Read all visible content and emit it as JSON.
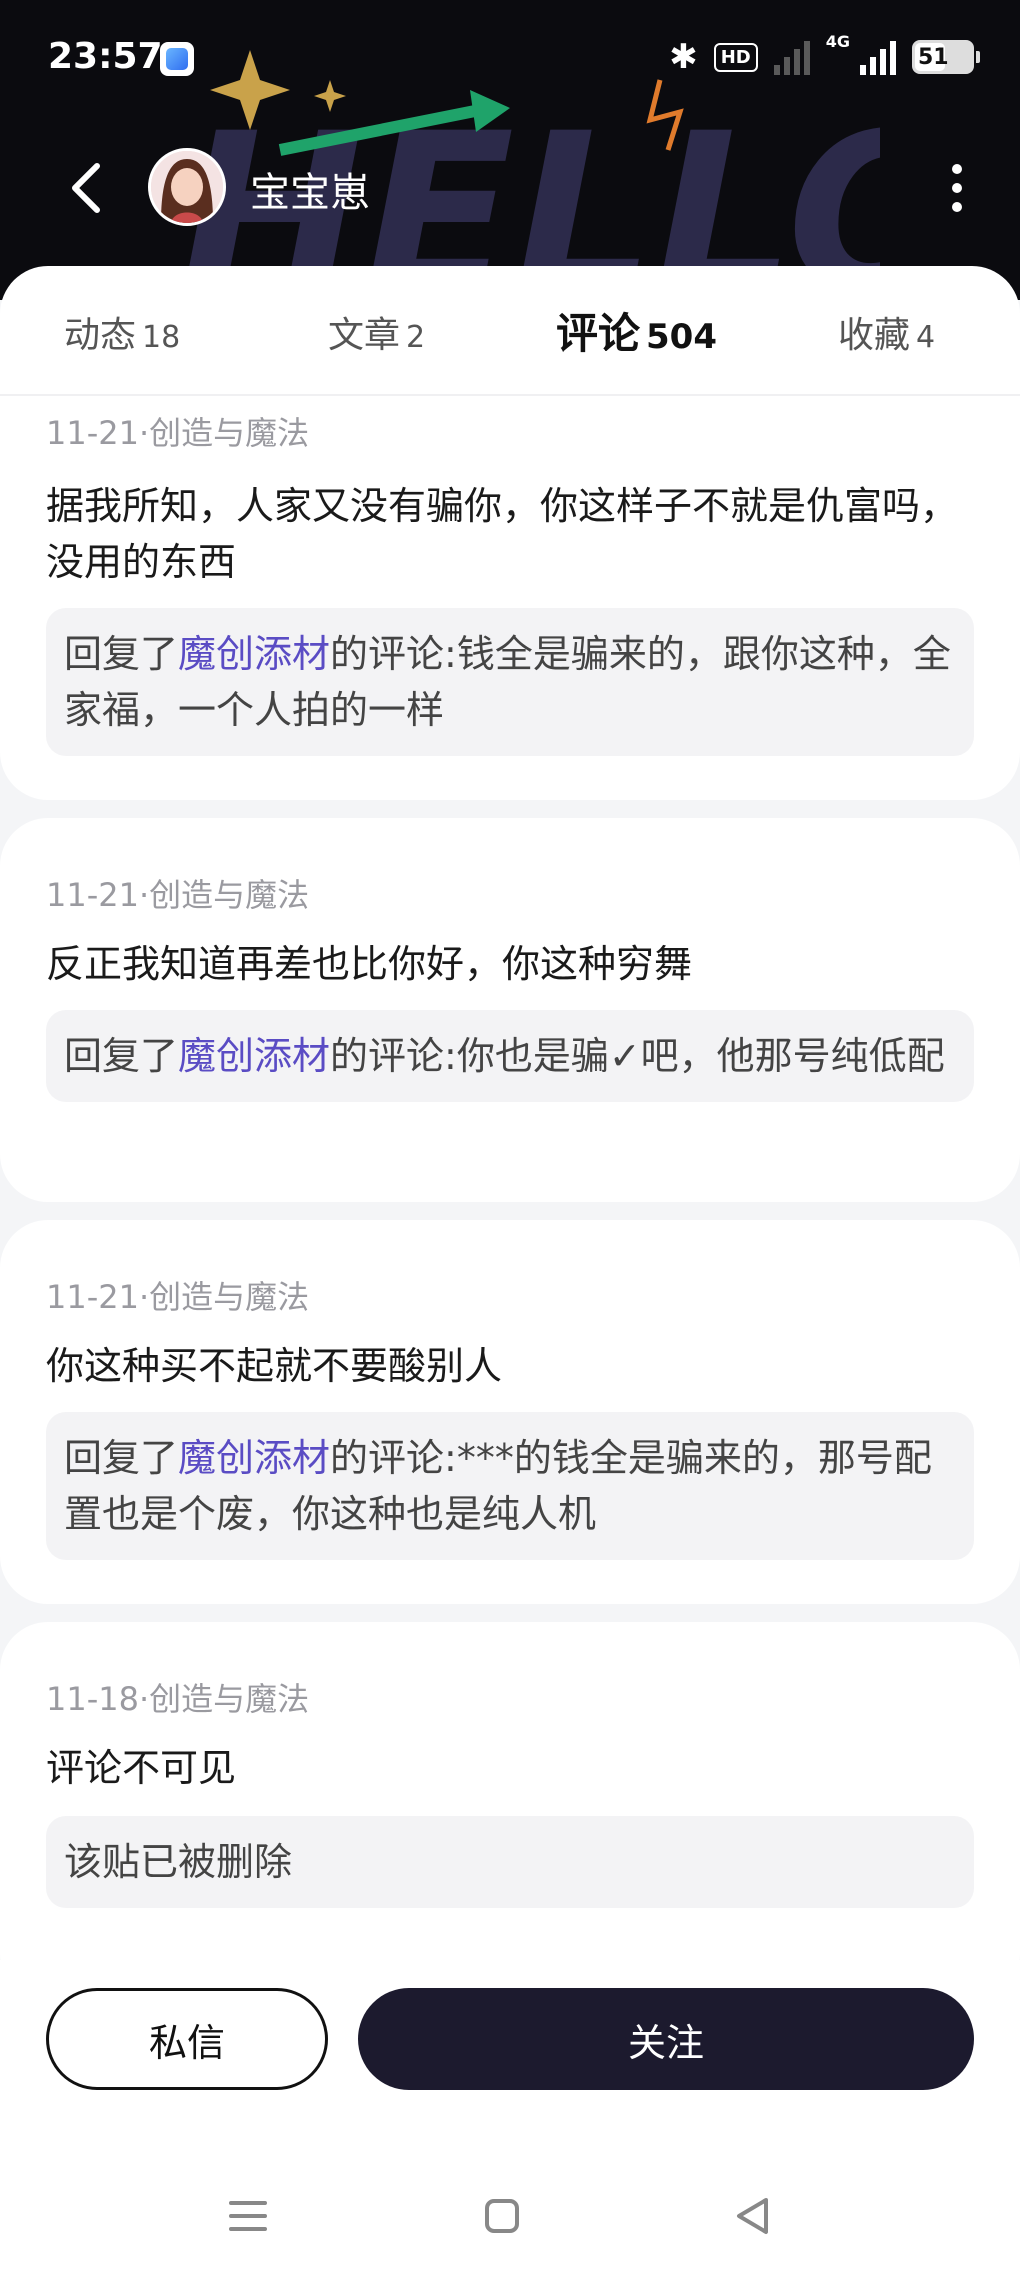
{
  "status_bar": {
    "time": "23:57",
    "hd_label": "HD",
    "network_label": "4G",
    "battery_level": "51"
  },
  "profile": {
    "username": "宝宝崽",
    "header_art_text": "HELLO."
  },
  "tabs": [
    {
      "label": "动态",
      "count": "18",
      "active": false
    },
    {
      "label": "文章",
      "count": "2",
      "active": false
    },
    {
      "label": "评论",
      "count": "504",
      "active": true
    },
    {
      "label": "收藏",
      "count": "4",
      "active": false
    }
  ],
  "comments": [
    {
      "meta": "11-21·创造与魔法",
      "text": "据我所知，人家又没有骗你，你这样子不就是仇富吗，没用的东西",
      "reply_prefix": "回复了",
      "reply_user": "魔创添材",
      "reply_rest": "的评论:钱全是骗来的，跟你这种，全家福，一个人拍的一样"
    },
    {
      "meta": "11-21·创造与魔法",
      "text": "反正我知道再差也比你好，你这种穷舞",
      "reply_prefix": "回复了",
      "reply_user": "魔创添材",
      "reply_rest": "的评论:你也是骗✓吧，他那号纯低配"
    },
    {
      "meta": "11-21·创造与魔法",
      "text": "你这种买不起就不要酸别人",
      "reply_prefix": "回复了",
      "reply_user": "魔创添材",
      "reply_rest": "的评论:***的钱全是骗来的，那号配置也是个废，你这种也是纯人机"
    },
    {
      "meta": "11-18·创造与魔法",
      "text": "评论不可见",
      "reply_text": "该贴已被删除"
    }
  ],
  "actions": {
    "message_label": "私信",
    "follow_label": "关注"
  },
  "icons": {
    "back": "back-arrow-icon",
    "more": "more-vertical-icon",
    "nav_menu": "menu-icon",
    "nav_home": "home-square-icon",
    "nav_back": "back-triangle-icon"
  },
  "colors": {
    "header_bg": "#0b0b0f",
    "accent_purple": "#5a4cc4",
    "tab_highlight": "#b9a8ff",
    "follow_button": "#1c1a2e"
  }
}
